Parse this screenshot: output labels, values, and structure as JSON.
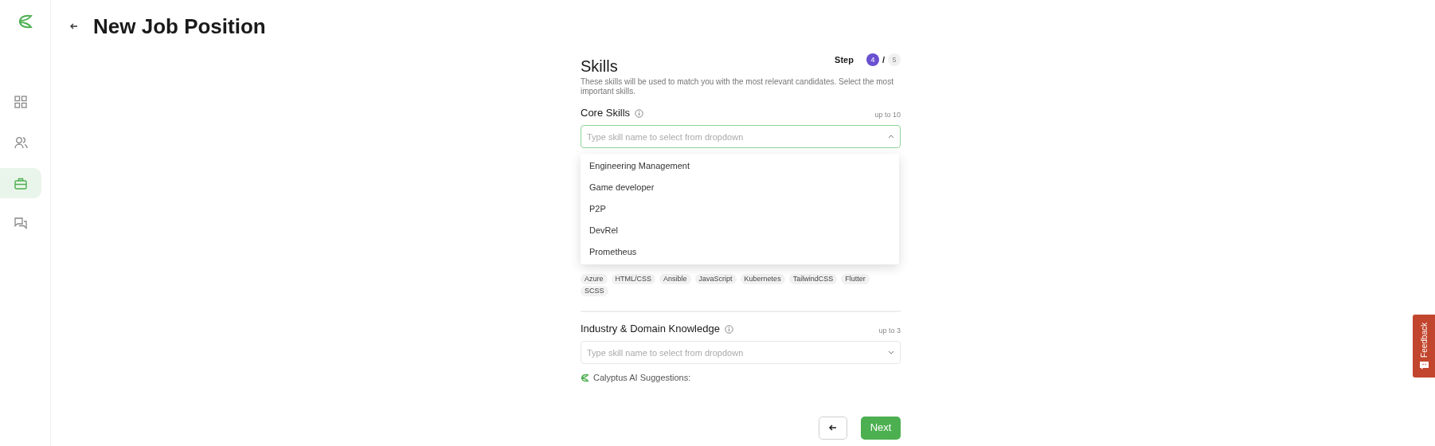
{
  "sidebar": {
    "items": [
      {
        "kind": "dashboard",
        "selected": false
      },
      {
        "kind": "people",
        "selected": false
      },
      {
        "kind": "jobs",
        "selected": true
      },
      {
        "kind": "messages",
        "selected": false
      }
    ]
  },
  "header": {
    "title": "New Job Position"
  },
  "form": {
    "title": "Skills",
    "step_label": "Step",
    "step_separator": "/",
    "steps": [
      {
        "label": "4",
        "selected": true
      },
      {
        "label": "5",
        "selected": false
      }
    ],
    "description": "These skills will be used to match you with the most relevant candidates. Select the most important skills.",
    "sections": [
      {
        "title": "Core Skills",
        "limit": "up to 10",
        "placeholder": "Type skill name to select from dropdown",
        "expanded": true,
        "options": [
          "Engineering Management",
          "Game developer",
          "P2P",
          "DevRel",
          "Prometheus"
        ],
        "chips": [
          "Azure",
          "HTML/CSS",
          "Ansible",
          "JavaScript",
          "Kubernetes",
          "TailwindCSS",
          "Flutter",
          "SCSS"
        ]
      },
      {
        "title": "Industry & Domain Knowledge",
        "limit": "up to 3",
        "placeholder": "Type skill name to select from dropdown",
        "expanded": false,
        "suggestions_label": "Calyptus AI Suggestions:"
      }
    ],
    "next_button": "Next"
  },
  "feedback": {
    "label": "Feedback"
  }
}
